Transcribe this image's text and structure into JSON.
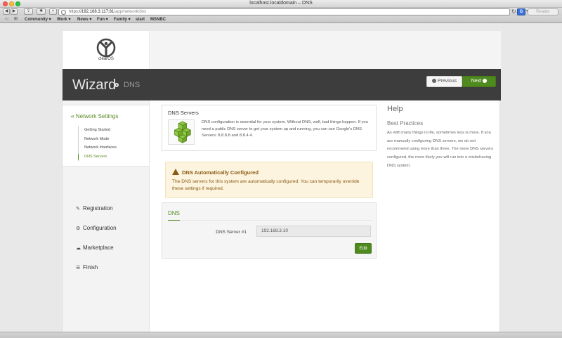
{
  "browser": {
    "window_title": "localhost.localdomain – DNS",
    "url_scheme": "https",
    "url_host": "192.168.3.117:81",
    "url_path": "/app/network/dns",
    "search_engine_label": "G",
    "reader_label": "Reader",
    "bookmarks": [
      "Community ▾",
      "Work ▾",
      "News ▾",
      "Fun ▾",
      "Family ▾",
      "start",
      "MSNBC"
    ]
  },
  "logo": {
    "text": "clearOS"
  },
  "banner": {
    "title": "Wizard",
    "subtitle": "DNS",
    "prev_label": "Previous",
    "next_label": "Next"
  },
  "sidebar": {
    "section_title": "Network Settings",
    "sub_items": [
      "Getting Started",
      "Network Mode",
      "Network Interfaces",
      "DNS Servers"
    ],
    "main_items": [
      "Registration",
      "Configuration",
      "Marketplace",
      "Finish"
    ]
  },
  "dns_servers_card": {
    "title": "DNS Servers",
    "body": "DNS configuration is essential for your system. Without DNS, well, bad things happen. If you need a public DNS server to get your system up and running, you can use Google's DNS Servers: 8.8.8.8 and 8.8.4.4."
  },
  "alert": {
    "title": "DNS Automatically Configured",
    "body": "The DNS servers for this system are automatically configured. You can temporarily override these settings if required."
  },
  "dns_form": {
    "title": "DNS",
    "field_label": "DNS Server #1",
    "field_value": "192.168.3.10",
    "edit_label": "Edit"
  },
  "help": {
    "title": "Help",
    "subtitle": "Best Practices",
    "body": "As with many things in life, sometimes less is more. If you are manually configuring DNS servers, we do not recommend using more than three. The more DNS servers configured, the more likely you will run into a misbehaving DNS system."
  },
  "colors": {
    "accent_green": "#5b8b24",
    "button_green": "#4f8a1f",
    "banner_dark": "#3d3d3d",
    "alert_bg": "#fcf4df",
    "alert_text": "#8a5a12"
  }
}
